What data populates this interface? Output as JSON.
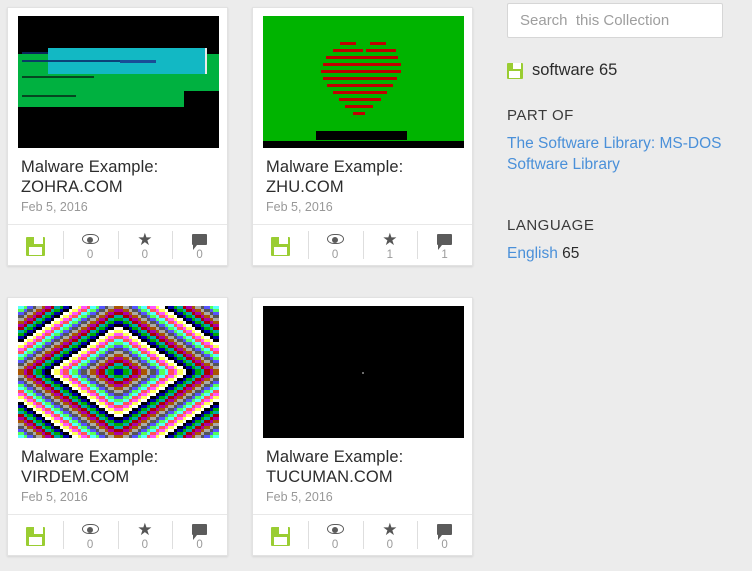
{
  "background_color": "#ececec",
  "accent_link_color": "#4a90d9",
  "floppy_color": "#9acd32",
  "results": {
    "cards": [
      {
        "title": "Malware Example: ZOHRA.COM",
        "date": "Feb 5, 2016",
        "thumbnail": "dos-screen-zohra",
        "stats": {
          "collection_icon": "floppy-disk-icon",
          "views_icon": "eye-icon",
          "views": "0",
          "favorites_icon": "star-icon",
          "favorites": "0",
          "comments_icon": "comment-icon",
          "comments": "0"
        }
      },
      {
        "title": "Malware Example: ZHU.COM",
        "date": "Feb 5, 2016",
        "thumbnail": "dos-screen-zhu-heart",
        "stats": {
          "collection_icon": "floppy-disk-icon",
          "views_icon": "eye-icon",
          "views": "0",
          "favorites_icon": "star-icon",
          "favorites": "1",
          "comments_icon": "comment-icon",
          "comments": "1"
        }
      },
      {
        "title": "Malware Example: VIRDEM.COM",
        "date": "Feb 5, 2016",
        "thumbnail": "ega-diamond-virdem",
        "stats": {
          "collection_icon": "floppy-disk-icon",
          "views_icon": "eye-icon",
          "views": "0",
          "favorites_icon": "star-icon",
          "favorites": "0",
          "comments_icon": "comment-icon",
          "comments": "0"
        }
      },
      {
        "title": "Malware Example: TUCUMAN.COM",
        "date": "Feb 5, 2016",
        "thumbnail": "black-screen-tucuman",
        "stats": {
          "collection_icon": "floppy-disk-icon",
          "views_icon": "eye-icon",
          "views": "0",
          "favorites_icon": "star-icon",
          "favorites": "0",
          "comments_icon": "comment-icon",
          "comments": "0"
        }
      }
    ]
  },
  "sidebar": {
    "search": {
      "placeholder": "Search  this Collection",
      "value": ""
    },
    "media_type": {
      "icon": "floppy-disk-icon",
      "label": "software 65"
    },
    "facets": [
      {
        "heading": "PART OF",
        "links": [
          {
            "text": "The Software Library: MS-DOS",
            "count": ""
          },
          {
            "text": "Software Library",
            "count": ""
          }
        ]
      },
      {
        "heading": "LANGUAGE",
        "links": [
          {
            "text": "English",
            "count": " 65"
          }
        ]
      }
    ]
  }
}
